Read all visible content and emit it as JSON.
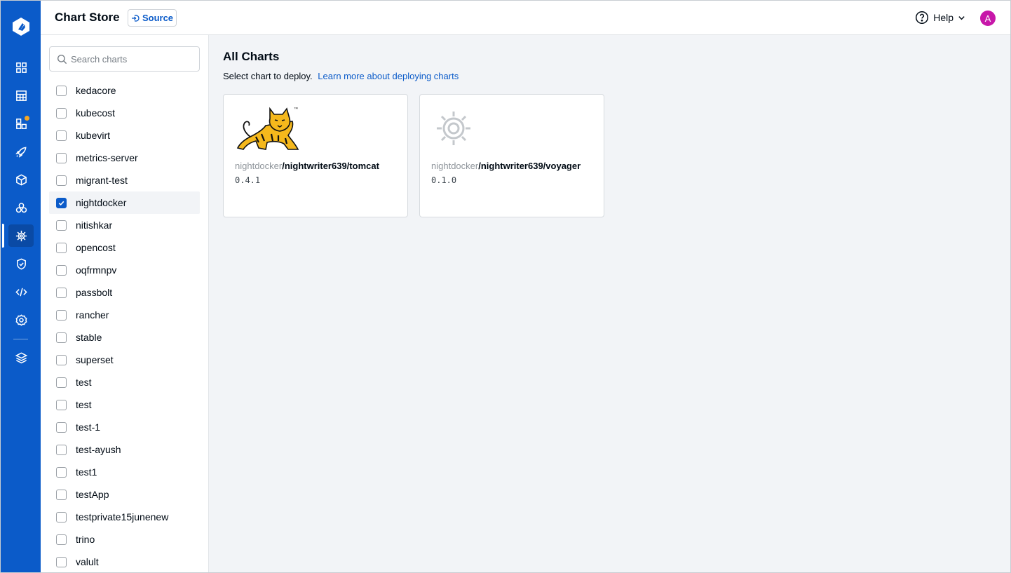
{
  "header": {
    "title": "Chart Store",
    "source_label": "Source",
    "help_label": "Help",
    "avatar_initial": "A"
  },
  "rail": {
    "items": [
      {
        "name": "app-list-icon"
      },
      {
        "name": "resource-browser-icon"
      },
      {
        "name": "app-groups-icon",
        "badge": true
      },
      {
        "name": "deployment-rocket-icon"
      },
      {
        "name": "jobs-cube-icon"
      },
      {
        "name": "clusters-icon"
      },
      {
        "name": "chart-store-helm-icon",
        "active": true
      },
      {
        "name": "security-shield-icon"
      },
      {
        "name": "code-icon"
      },
      {
        "name": "settings-gear-icon"
      },
      {
        "name": "stack-layers-icon"
      }
    ]
  },
  "filter": {
    "search_placeholder": "Search charts",
    "sources": [
      {
        "label": "kedacore",
        "checked": false
      },
      {
        "label": "kubecost",
        "checked": false
      },
      {
        "label": "kubevirt",
        "checked": false
      },
      {
        "label": "metrics-server",
        "checked": false
      },
      {
        "label": "migrant-test",
        "checked": false
      },
      {
        "label": "nightdocker",
        "checked": true
      },
      {
        "label": "nitishkar",
        "checked": false
      },
      {
        "label": "opencost",
        "checked": false
      },
      {
        "label": "oqfrmnpv",
        "checked": false
      },
      {
        "label": "passbolt",
        "checked": false
      },
      {
        "label": "rancher",
        "checked": false
      },
      {
        "label": "stable",
        "checked": false
      },
      {
        "label": "superset",
        "checked": false
      },
      {
        "label": "test",
        "checked": false
      },
      {
        "label": "test",
        "checked": false
      },
      {
        "label": "test-1",
        "checked": false
      },
      {
        "label": "test-ayush",
        "checked": false
      },
      {
        "label": "test1",
        "checked": false
      },
      {
        "label": "testApp",
        "checked": false
      },
      {
        "label": "testprivate15junenew",
        "checked": false
      },
      {
        "label": "trino",
        "checked": false
      },
      {
        "label": "valult",
        "checked": false
      }
    ]
  },
  "main": {
    "heading": "All Charts",
    "subtitle": "Select chart to deploy.",
    "learn_more": "Learn more about deploying charts",
    "charts": [
      {
        "repo": "nightdocker",
        "path": "/nightwriter639/tomcat",
        "version": "0.4.1",
        "icon": "tomcat-logo"
      },
      {
        "repo": "nightdocker",
        "path": "/nightwriter639/voyager",
        "version": "0.1.0",
        "icon": "helm-placeholder-icon"
      }
    ]
  },
  "colors": {
    "brand": "#0b5bc9",
    "avatar": "#c717a9",
    "badge": "#f5a623"
  }
}
